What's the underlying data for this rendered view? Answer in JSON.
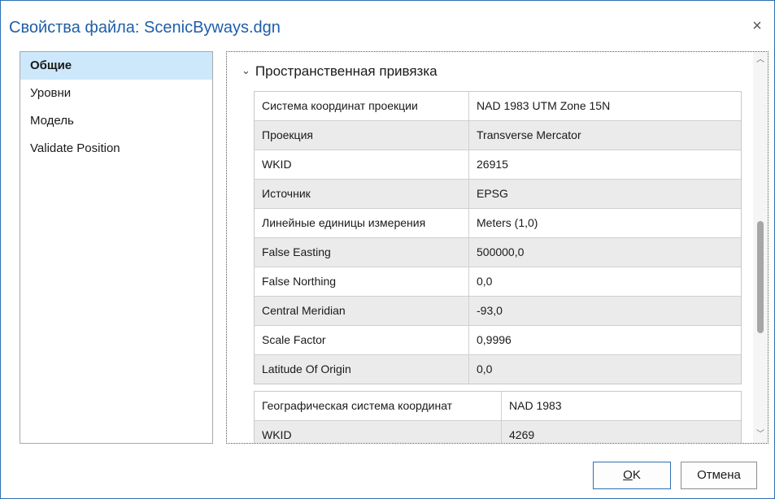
{
  "window": {
    "title": "Свойства файла: ScenicByways.dgn",
    "close_glyph": "×"
  },
  "nav": {
    "items": [
      {
        "label": "Общие"
      },
      {
        "label": "Уровни"
      },
      {
        "label": "Модель"
      },
      {
        "label": "Validate Position"
      }
    ]
  },
  "section": {
    "title": "Пространственная привязка",
    "chevron": "⌄"
  },
  "projected": [
    {
      "key": "Система координат проекции",
      "value": "NAD 1983 UTM Zone 15N"
    },
    {
      "key": "Проекция",
      "value": "Transverse Mercator"
    },
    {
      "key": "WKID",
      "value": "26915"
    },
    {
      "key": "Источник",
      "value": "EPSG"
    },
    {
      "key": "Линейные единицы измерения",
      "value": "Meters (1,0)"
    },
    {
      "key": "False Easting",
      "value": "500000,0"
    },
    {
      "key": "False Northing",
      "value": "0,0"
    },
    {
      "key": "Central Meridian",
      "value": "-93,0"
    },
    {
      "key": "Scale Factor",
      "value": "0,9996"
    },
    {
      "key": "Latitude Of Origin",
      "value": "0,0"
    }
  ],
  "geographic": [
    {
      "key": "Географическая система координат",
      "value": "NAD 1983"
    },
    {
      "key": "WKID",
      "value": "4269"
    }
  ],
  "scrollbar": {
    "up_glyph": "︿",
    "down_glyph": "﹀",
    "position": 0.45
  },
  "buttons": {
    "ok_mnemonic": "O",
    "ok_rest": "K",
    "cancel_label": "Отмена"
  },
  "colors": {
    "accent": "#1f5ea8",
    "selection": "#cde8fb",
    "alt_row": "#ebebeb"
  }
}
